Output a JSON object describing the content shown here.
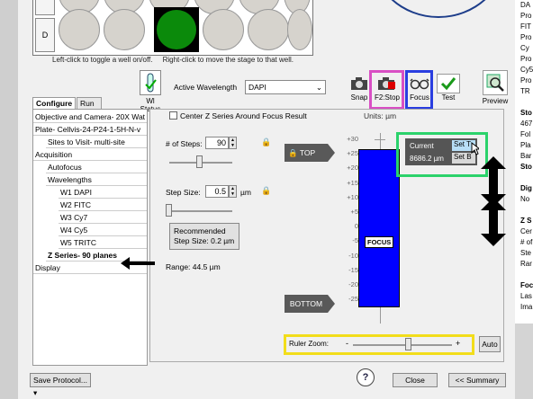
{
  "plate": {
    "row_label": "D",
    "hint_left": "Left-click to toggle a well on/off.",
    "hint_right": "Right-click to move the stage to that well."
  },
  "toolbar": {
    "wl_status_label": "Wl Status",
    "active_wavelength_label": "Active Wavelength",
    "active_wavelength_value": "DAPI",
    "snap_label": "Snap",
    "stop_label": "F2:Stop",
    "focus_label": "Focus",
    "test_label": "Test",
    "preview_label": "Preview"
  },
  "right_panel": {
    "lines": [
      "DA",
      "Pro",
      "FIT",
      "Pro",
      "Cy",
      "Pro",
      "Cy5",
      "Pro",
      "TR",
      "",
      "Sto",
      "467",
      "Fol",
      "Pla",
      "Bar",
      "Sto",
      "",
      "Dig",
      "No",
      "",
      "Z S",
      "Cer",
      "# of",
      "Ste",
      "Rar",
      "",
      "Foc",
      "Las",
      "Ima"
    ]
  },
  "tabs": [
    {
      "label": "Configure",
      "active": true
    },
    {
      "label": "Run",
      "active": false
    }
  ],
  "nav": [
    {
      "label": "Objective and Camera- 20X Wat",
      "indent": 0
    },
    {
      "label": "Plate- Cellvis-24-P24-1-5H-N-v",
      "indent": 0
    },
    {
      "label": "Sites to Visit- multi-site",
      "indent": 1
    },
    {
      "label": "Acquisition",
      "indent": 0
    },
    {
      "label": "Autofocus",
      "indent": 1
    },
    {
      "label": "Wavelengths",
      "indent": 1
    },
    {
      "label": "W1 DAPI",
      "indent": 2
    },
    {
      "label": "W2 FITC",
      "indent": 2
    },
    {
      "label": "W3 Cy7",
      "indent": 2
    },
    {
      "label": "W4 Cy5",
      "indent": 2
    },
    {
      "label": "W5 TRITC",
      "indent": 2
    },
    {
      "label": "Z Series- 90 planes",
      "indent": 1
    },
    {
      "label": "Display",
      "indent": 0
    }
  ],
  "zseries": {
    "center_checkbox_label": "Center Z Series Around Focus Result",
    "steps_label": "# of Steps:",
    "steps_value": "90",
    "step_size_label": "Step Size:",
    "step_size_value": "0.5",
    "step_size_unit": "µm",
    "recommended_line1": "Recommended",
    "recommended_line2": "Step Size: 0.2 µm",
    "range_text": "Range: 44.5 µm",
    "units_text": "Units: µm",
    "top_label": "TOP",
    "bottom_label": "BOTTOM",
    "focus_label": "FOCUS",
    "ticks": [
      "+30",
      "+25",
      "+20",
      "+15",
      "+10",
      "+5",
      "0",
      "-5",
      "-10",
      "-15",
      "-20",
      "-25"
    ],
    "current_label": "Current",
    "current_value": "8686.2 µm",
    "set_top_label": "Set T",
    "set_bottom_label": "Set B",
    "ruler_zoom_label": "Ruler Zoom:",
    "ruler_minus": "-",
    "ruler_plus": "+",
    "auto_label": "Auto"
  },
  "footer": {
    "save_protocol_label": "Save Protocol...",
    "close_label": "Close",
    "summary_label": "<< Summary"
  },
  "colors": {
    "well_on": "#0b8a0b",
    "focus_bar": "#0000ff",
    "highlight_green": "#2bd26b",
    "highlight_magenta": "#d94fc4",
    "highlight_blue": "#2a3ee0",
    "highlight_yellow": "#f2dd1a"
  }
}
